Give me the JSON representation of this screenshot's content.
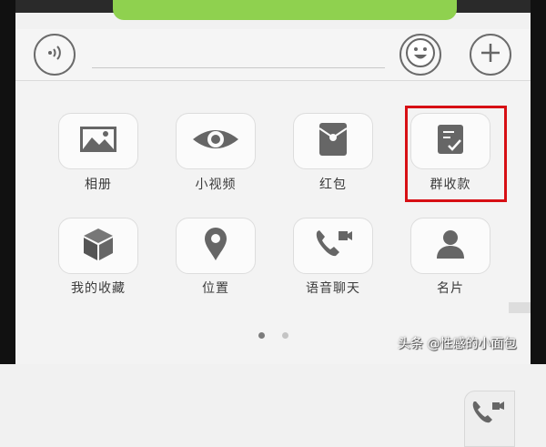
{
  "colors": {
    "accent": "#8fd14f",
    "highlight": "#d70f14",
    "icon": "#666666"
  },
  "input_bar": {
    "voice_icon": "voice-input-icon",
    "emoji_icon": "emoji-icon",
    "plus_icon": "plus-icon"
  },
  "panel": {
    "page_count": 2,
    "active_page": 1,
    "items": [
      {
        "label": "相册",
        "icon": "album-icon"
      },
      {
        "label": "小视频",
        "icon": "eye-video-icon"
      },
      {
        "label": "红包",
        "icon": "red-packet-icon"
      },
      {
        "label": "群收款",
        "icon": "group-payment-icon",
        "highlighted": true
      },
      {
        "label": "我的收藏",
        "icon": "cube-favorites-icon"
      },
      {
        "label": "位置",
        "icon": "location-pin-icon"
      },
      {
        "label": "语音聊天",
        "icon": "voice-call-icon"
      },
      {
        "label": "名片",
        "icon": "contact-card-icon"
      }
    ]
  },
  "watermark": {
    "text": "头条 @性感的小面包"
  }
}
